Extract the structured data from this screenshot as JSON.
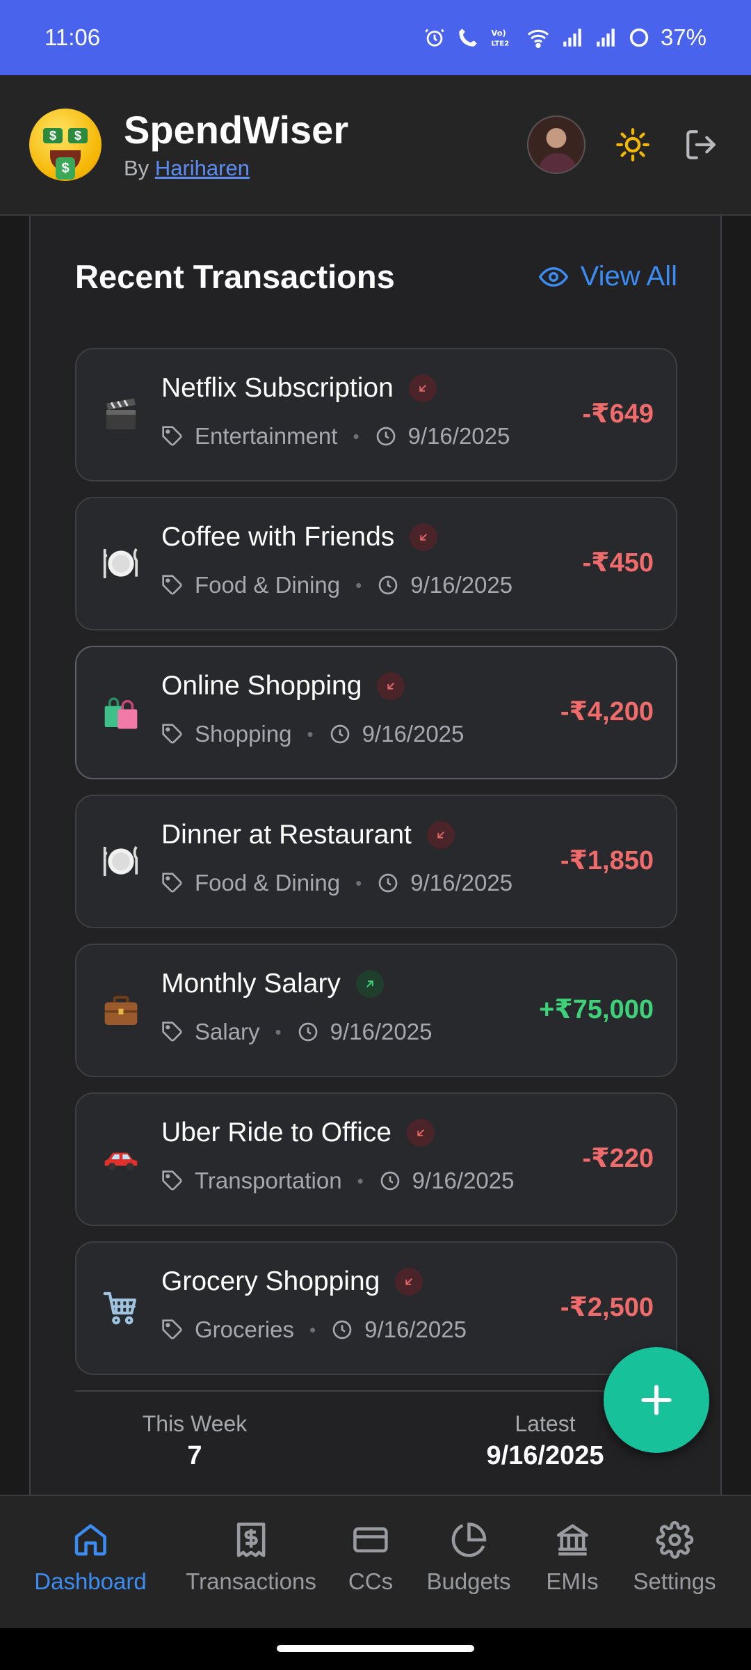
{
  "status_bar": {
    "time": "11:06",
    "battery": "37%",
    "icons": [
      "alarm-icon",
      "wifi-call-icon",
      "volte-icon",
      "wifi-icon",
      "signal-icon",
      "signal-icon",
      "battery-icon"
    ]
  },
  "header": {
    "app_name": "SpendWiser",
    "by_prefix": "By",
    "author": "Hariharen",
    "icons": [
      "money-face-logo",
      "avatar",
      "sun-icon",
      "logout-icon"
    ]
  },
  "recent": {
    "title": "Recent Transactions",
    "view_all": "View All",
    "transactions": [
      {
        "emoji": "clapper-icon",
        "name": "Netflix Subscription",
        "direction": "out",
        "category": "Entertainment",
        "date": "9/16/2025",
        "amount": "-₹649"
      },
      {
        "emoji": "plate-icon",
        "name": "Coffee with Friends",
        "direction": "out",
        "category": "Food & Dining",
        "date": "9/16/2025",
        "amount": "-₹450"
      },
      {
        "emoji": "shopping-bags-icon",
        "name": "Online Shopping",
        "direction": "out",
        "category": "Shopping",
        "date": "9/16/2025",
        "amount": "-₹4,200"
      },
      {
        "emoji": "plate-icon",
        "name": "Dinner at Restaurant",
        "direction": "out",
        "category": "Food & Dining",
        "date": "9/16/2025",
        "amount": "-₹1,850"
      },
      {
        "emoji": "briefcase-icon",
        "name": "Monthly Salary",
        "direction": "in",
        "category": "Salary",
        "date": "9/16/2025",
        "amount": "+₹75,000"
      },
      {
        "emoji": "car-icon",
        "name": "Uber Ride to Office",
        "direction": "out",
        "category": "Transportation",
        "date": "9/16/2025",
        "amount": "-₹220"
      },
      {
        "emoji": "cart-icon",
        "name": "Grocery Shopping",
        "direction": "out",
        "category": "Groceries",
        "date": "9/16/2025",
        "amount": "-₹2,500"
      }
    ],
    "summary": {
      "week_label": "This Week",
      "week_value": "7",
      "latest_label": "Latest",
      "latest_value": "9/16/2025"
    }
  },
  "fab": {
    "icon": "plus-icon"
  },
  "nav": {
    "items": [
      {
        "label": "Dashboard",
        "icon": "home-icon",
        "active": true
      },
      {
        "label": "Transactions",
        "icon": "receipt-icon",
        "active": false
      },
      {
        "label": "CCs",
        "icon": "credit-card-icon",
        "active": false
      },
      {
        "label": "Budgets",
        "icon": "pie-chart-icon",
        "active": false
      },
      {
        "label": "EMIs",
        "icon": "bank-icon",
        "active": false
      },
      {
        "label": "Settings",
        "icon": "gear-icon",
        "active": false
      }
    ]
  },
  "colors": {
    "status_bar": "#4a63ec",
    "accent": "#3b8cf3",
    "negative": "#f06b6b",
    "positive": "#3fd07a",
    "fab": "#17c29b",
    "sun": "#f5b800"
  }
}
